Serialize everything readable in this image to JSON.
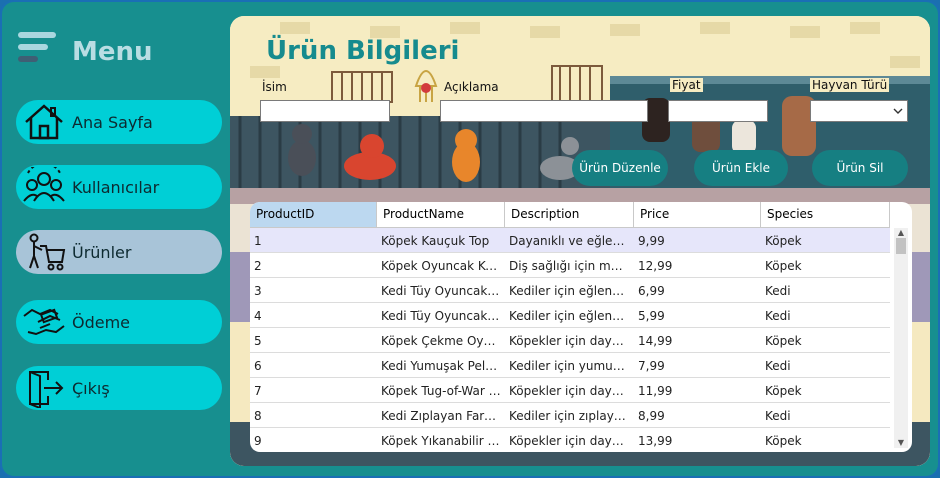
{
  "sidebar": {
    "title": "Menu",
    "items": [
      {
        "label": "Ana Sayfa",
        "icon": "home-icon"
      },
      {
        "label": "Kullanıcılar",
        "icon": "users-icon"
      },
      {
        "label": "Ürünler",
        "icon": "shopping-cart-icon",
        "active": true
      },
      {
        "label": "Ödeme",
        "icon": "payment-icon"
      },
      {
        "label": "Çıkış",
        "icon": "exit-icon"
      }
    ]
  },
  "form": {
    "title": "Ürün Bilgileri",
    "name_label": "İsim",
    "desc_label": "Açıklama",
    "price_label": "Fiyat",
    "species_label": "Hayvan Türü",
    "name_value": "",
    "desc_value": "",
    "price_value": "",
    "species_value": ""
  },
  "buttons": {
    "edit": "Ürün Düzenle",
    "add": "Ürün Ekle",
    "delete": "Ürün Sil"
  },
  "grid": {
    "columns": [
      "ProductID",
      "ProductName",
      "Description",
      "Price",
      "Species"
    ],
    "rows": [
      [
        "1",
        "Köpek Kauçuk Top",
        "Dayanıklı ve eğlenceli...",
        "9,99",
        "Köpek"
      ],
      [
        "2",
        "Köpek Oyuncak Kemik",
        "Diş sağlığı için müke...",
        "12,99",
        "Köpek"
      ],
      [
        "3",
        "Kedi Tüy Oyuncak Fare",
        "Kediler için eğlenceli ...",
        "6,99",
        "Kedi"
      ],
      [
        "4",
        "Kedi Tüy Oyuncak Top",
        "Kediler için eğlenceli ...",
        "5,99",
        "Kedi"
      ],
      [
        "5",
        "Köpek Çekme Oyunc...",
        "Köpekler için dayanık...",
        "14,99",
        "Köpek"
      ],
      [
        "6",
        "Kedi Yumuşak Peluş ...",
        "Kediler için yumuşak ...",
        "7,99",
        "Kedi"
      ],
      [
        "7",
        "Köpek Tug-of-War O...",
        "Köpekler için dayanık...",
        "11,99",
        "Köpek"
      ],
      [
        "8",
        "Kedi Zıplayan Fare O...",
        "Kediler için zıplayan f...",
        "8,99",
        "Kedi"
      ],
      [
        "9",
        "Köpek Yıkanabilir Sak...",
        "Köpekler için dayanık...",
        "13,99",
        "Köpek"
      ]
    ]
  },
  "colors": {
    "frame": "#178f8f",
    "nav_button": "#00cfd6",
    "nav_active": "#a8c4d8",
    "accent": "#167f82",
    "title": "#168b8e",
    "background": "#f6ecc2"
  }
}
